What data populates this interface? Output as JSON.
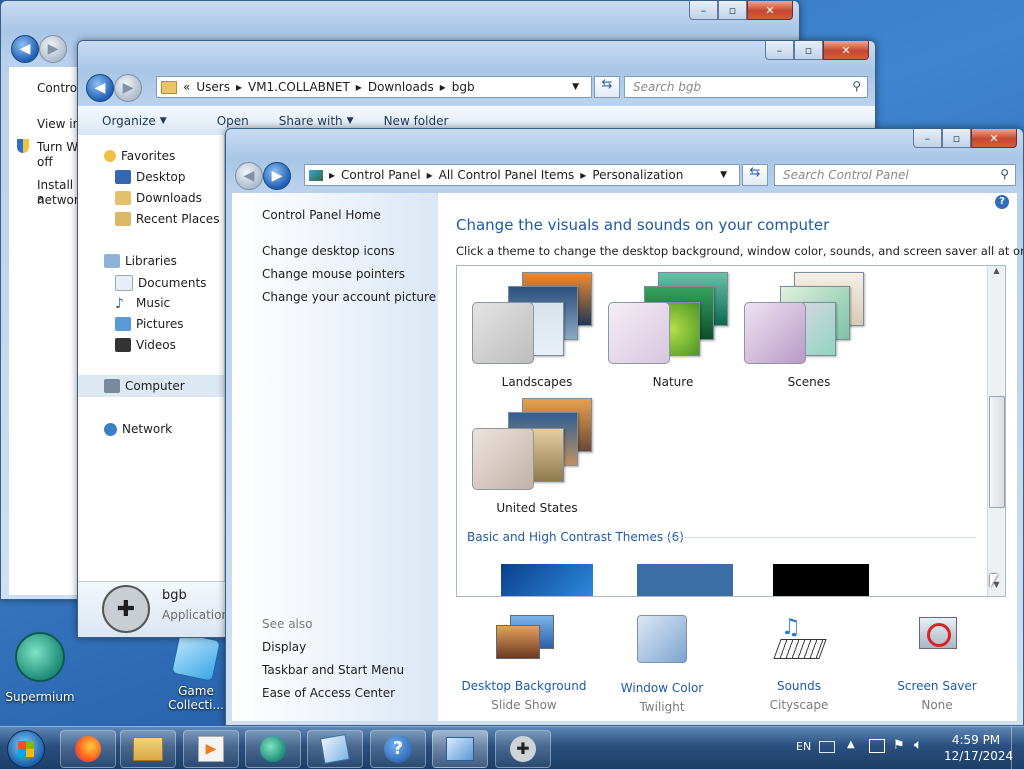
{
  "back_window": {
    "left_items": [
      "Control",
      "View in",
      "Turn Wi",
      "off",
      "Install a",
      "network"
    ]
  },
  "explorer": {
    "breadcrumb": [
      "«",
      "Users",
      "VM1.COLLABNET",
      "Downloads",
      "bgb"
    ],
    "search_placeholder": "Search bgb",
    "toolbar": {
      "organize": "Organize",
      "open": "Open",
      "share_with": "Share with",
      "new_folder": "New folder"
    },
    "nav": {
      "favorites": "Favorites",
      "desktop": "Desktop",
      "downloads": "Downloads",
      "recent_places": "Recent Places",
      "libraries": "Libraries",
      "documents": "Documents",
      "music": "Music",
      "pictures": "Pictures",
      "videos": "Videos",
      "computer": "Computer",
      "network": "Network"
    },
    "details": {
      "name": "bgb",
      "type": "Application"
    }
  },
  "personalization": {
    "breadcrumb": [
      "Control Panel",
      "All Control Panel Items",
      "Personalization"
    ],
    "search_placeholder": "Search Control Panel",
    "left": {
      "home": "Control Panel Home",
      "links": [
        "Change desktop icons",
        "Change mouse pointers",
        "Change your account picture"
      ],
      "see_also": "See also",
      "see_also_links": [
        "Display",
        "Taskbar and Start Menu",
        "Ease of Access Center"
      ]
    },
    "heading": "Change the visuals and sounds on your computer",
    "subheading": "Click a theme to change the desktop background, window color, sounds, and screen saver all at once.",
    "themes": [
      "Landscapes",
      "Nature",
      "Scenes",
      "United States"
    ],
    "basic_section": "Basic and High Contrast Themes (6)",
    "bottom": [
      {
        "title": "Desktop Background",
        "value": "Slide Show"
      },
      {
        "title": "Window Color",
        "value": "Twilight"
      },
      {
        "title": "Sounds",
        "value": "Cityscape"
      },
      {
        "title": "Screen Saver",
        "value": "None"
      }
    ]
  },
  "desktop_icons": {
    "supermium": "Supermium",
    "game": "Game Collecti..."
  },
  "taskbar": {
    "lang": "EN",
    "time": "4:59 PM",
    "date": "12/17/2024"
  },
  "colors": {
    "link": "#1e5aa8",
    "heading": "#1e5aa8",
    "taskbar": "#2a4f7e"
  }
}
